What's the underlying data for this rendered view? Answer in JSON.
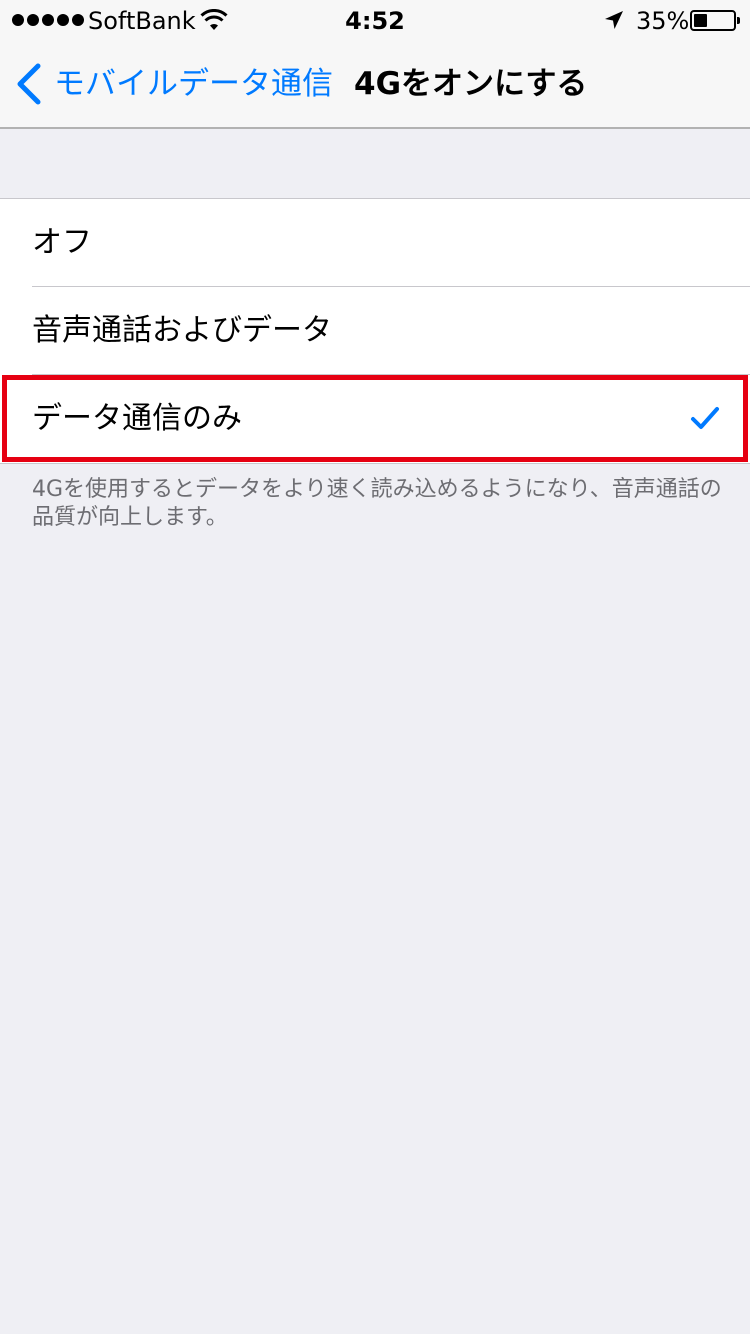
{
  "status_bar": {
    "carrier": "SoftBank",
    "time": "4:52",
    "battery_percent_label": "35%",
    "battery_level": 0.35,
    "signal_dots": 5,
    "icons": [
      "signal-dots-icon",
      "wifi-icon",
      "location-arrow-icon",
      "battery-icon"
    ]
  },
  "nav": {
    "back_label": "モバイルデータ通信",
    "title": "4Gをオンにする",
    "back_icon": "chevron-left-icon"
  },
  "options": [
    {
      "label": "オフ",
      "selected": false
    },
    {
      "label": "音声通話およびデータ",
      "selected": false
    },
    {
      "label": "データ通信のみ",
      "selected": true,
      "check_icon": "checkmark-icon"
    }
  ],
  "footer": {
    "note": "4Gを使用するとデータをより速く読み込めるようになり、音声通話の品質が向上します。"
  },
  "colors": {
    "accent": "#007AFF",
    "background": "#EFEFF4",
    "highlight_border": "#E60012",
    "footer_text": "#6D6D72"
  }
}
